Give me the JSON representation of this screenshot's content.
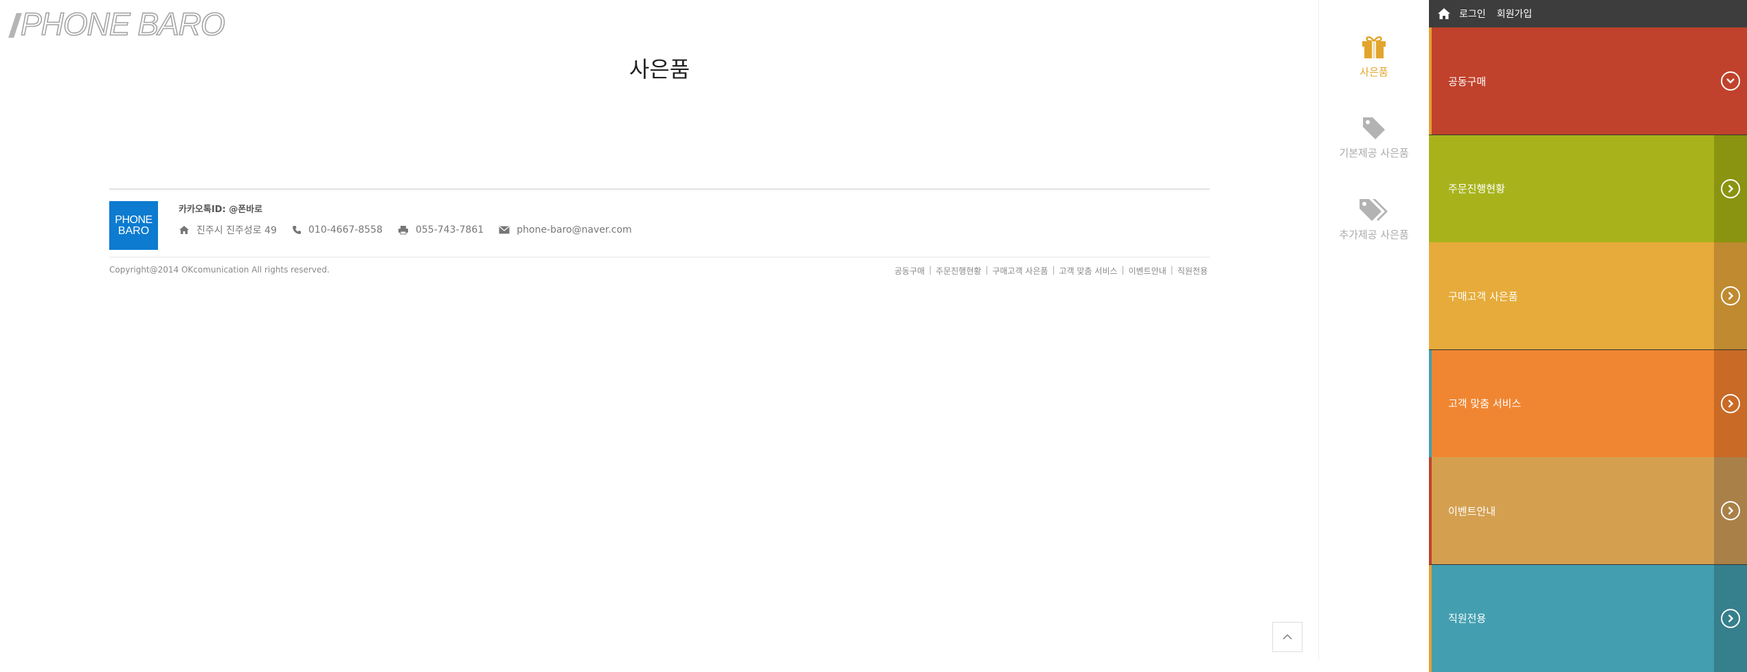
{
  "brand": {
    "logo_text": "PHONE BARO",
    "footer_logo_line1": "PHONE",
    "footer_logo_line2": "BARO"
  },
  "page_title": "사은품",
  "footer": {
    "kakao": "카카오톡ID: @폰바로",
    "address": "진주시 진주성로 49",
    "phone": "010-4667-8558",
    "fax": "055-743-7861",
    "email": "phone-baro@naver.com",
    "copyright": "Copyright@2014 OKcomunication All rights reserved.",
    "links": [
      "공동구매",
      "주문진행현황",
      "구매고객 사은품",
      "고객 맞춤 서비스",
      "이벤트안내",
      "직원전용"
    ]
  },
  "sub_nav": [
    {
      "label": "사은품",
      "icon": "gift-icon",
      "active": true
    },
    {
      "label": "기본제공 사은품",
      "icon": "tag-icon",
      "active": false
    },
    {
      "label": "추가제공 사은품",
      "icon": "tags-icon",
      "active": false
    }
  ],
  "topbar": {
    "login": "로그인",
    "signup": "회원가입",
    "icon": "home-icon"
  },
  "menu": [
    {
      "label": "공동구매",
      "color": "#c0422c",
      "accent": "#c0422c",
      "stripe": "#e5a030",
      "arrow": "chevron-down"
    },
    {
      "label": "주문진행현황",
      "color": "#a8b31c",
      "accent": "#8a9410",
      "stripe": "#a8b31c",
      "arrow": "chevron-right"
    },
    {
      "label": "구매고객 사은품",
      "color": "#e6ab3a",
      "accent": "#bf8a30",
      "stripe": "#e6ab3a",
      "arrow": "chevron-right"
    },
    {
      "label": "고객 맞춤 서비스",
      "color": "#f08632",
      "accent": "#c96a26",
      "stripe": "#3fa0b0",
      "arrow": "chevron-right"
    },
    {
      "label": "이벤트안내",
      "color": "#d4a050",
      "accent": "#a98048",
      "stripe": "#c0422c",
      "arrow": "chevron-right"
    },
    {
      "label": "직원전용",
      "color": "#439fb0",
      "accent": "#367f8c",
      "stripe": "#e5a030",
      "arrow": "chevron-right"
    }
  ]
}
